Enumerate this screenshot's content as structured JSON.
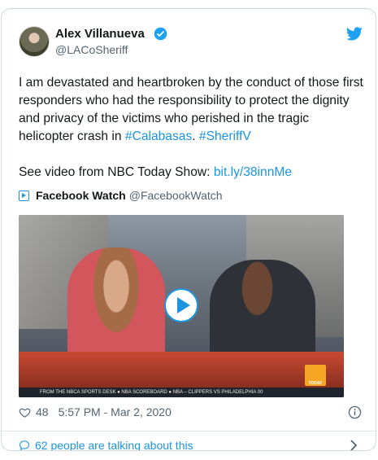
{
  "author": {
    "name": "Alex Villanueva",
    "handle": "@LACoSheriff"
  },
  "tweet": {
    "text_part1": "I am devastated and heartbroken by the conduct of those first responders who had the responsibility to protect the dignity and privacy of the victims who perished in the tragic helicopter crash in ",
    "hashtag1": "#Calabasas",
    "sep": ". ",
    "hashtag2": "#SheriffV",
    "line2_prefix": "See video from NBC Today Show: ",
    "link": "bit.ly/38innMe"
  },
  "source": {
    "name": "Facebook Watch",
    "handle": "@FacebookWatch"
  },
  "video": {
    "ticker": "FROM THE NBCA SPORTS DESK   ●   NBA SCOREBOARD   ●   NBA – CLIPPERS VS PHILADELPHIA 00",
    "logo_text": "TODAY"
  },
  "meta": {
    "likes": "48",
    "timestamp": "5:57 PM - Mar 2, 2020"
  },
  "footer": {
    "talking": "62 people are talking about this"
  },
  "colors": {
    "link": "#1b95e0",
    "muted": "#536471"
  },
  "icons": [
    "verified-icon",
    "twitter-bird-icon",
    "play-icon",
    "heart-icon",
    "info-icon",
    "comment-icon",
    "chevron-right-icon"
  ]
}
